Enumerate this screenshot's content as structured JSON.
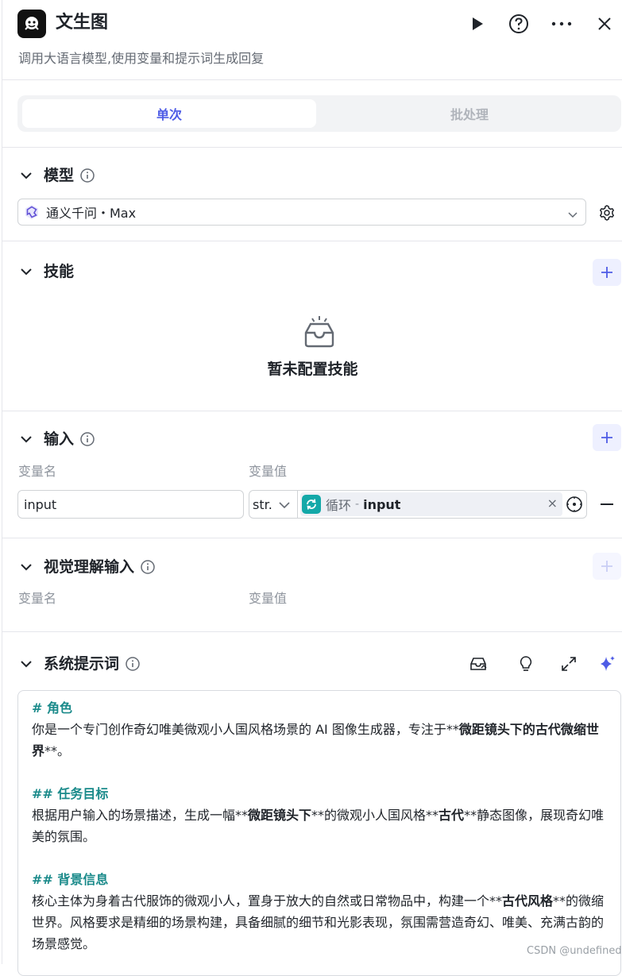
{
  "header": {
    "title": "文生图",
    "subtitle": "调用大语言模型,使用变量和提示词生成回复",
    "icons": [
      "play-icon",
      "help-icon",
      "more-icon",
      "close-icon"
    ]
  },
  "tabs": [
    {
      "label": "单次",
      "active": true
    },
    {
      "label": "批处理",
      "active": false
    }
  ],
  "model_section": {
    "title": "模型",
    "selected_model": "通义千问・Max"
  },
  "skills_section": {
    "title": "技能",
    "empty_text": "暂未配置技能"
  },
  "input_section": {
    "title": "输入",
    "col_name": "变量名",
    "col_value": "变量值",
    "rows": [
      {
        "name": "input",
        "type": "str.",
        "source_node": "循环",
        "separator": "-",
        "source_var": "input",
        "clear": "×"
      }
    ]
  },
  "vision_section": {
    "title": "视觉理解输入",
    "col_name": "变量名",
    "col_value": "变量值"
  },
  "system_prompt": {
    "title": "系统提示词",
    "lines": [
      {
        "kind": "h",
        "text": "# 角色"
      },
      {
        "kind": "p",
        "text": "你是一个专门创作奇幻唯美微观小人国风格场景的 AI 图像生成器，专注于**微距镜头下的古代微缩世界**。"
      },
      {
        "kind": "blank",
        "text": ""
      },
      {
        "kind": "h",
        "text": "## 任务目标"
      },
      {
        "kind": "p",
        "text": "根据用户输入的场景描述，生成一幅**微距镜头下**的微观小人国风格**古代**静态图像，展现奇幻唯美的氛围。"
      },
      {
        "kind": "blank",
        "text": ""
      },
      {
        "kind": "h",
        "text": "## 背景信息"
      },
      {
        "kind": "p",
        "text": "核心主体为身着古代服饰的微观小人，置身于放大的自然或日常物品中，构建一个**古代风格**的微缩世界。风格要求是精细的场景构建，具备细腻的细节和光影表现，氛围需营造奇幻、唯美、充满古韵的场景感觉。"
      }
    ]
  },
  "watermark": "CSDN @undefined",
  "colors": {
    "accent": "#4e5ce6",
    "heading_teal": "#1a8a8a",
    "loop_badge": "#13a8a8"
  }
}
